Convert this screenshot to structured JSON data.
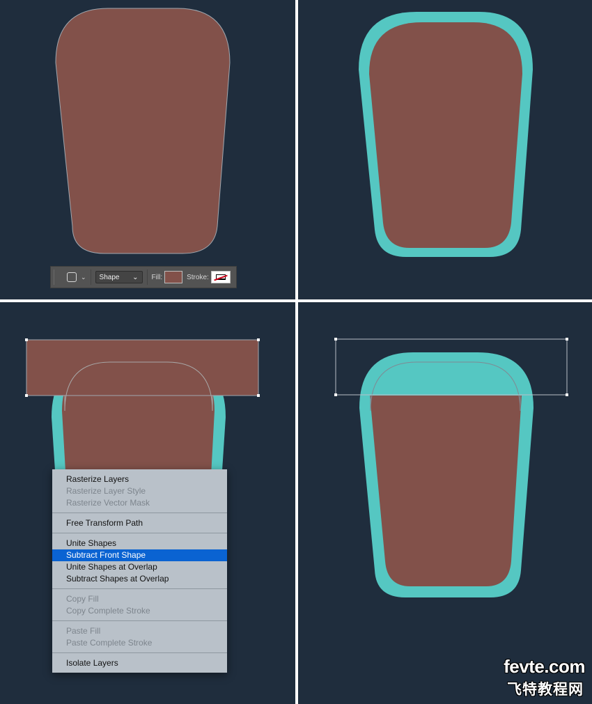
{
  "options_bar": {
    "shape_tool_icon": "rounded-rectangle-tool-icon",
    "mode_value": "Shape",
    "fill_label": "Fill:",
    "stroke_label": "Stroke:",
    "fill_color": "#82514a",
    "stroke_color": "none"
  },
  "colors": {
    "background": "#1f2d3d",
    "cup_fill": "#82514a",
    "cup_stroke": "#55c7c2",
    "menu_highlight": "#0a63d2"
  },
  "context_menu": {
    "groups": [
      [
        {
          "label": "Rasterize Layers",
          "state": "enabled"
        },
        {
          "label": "Rasterize Layer Style",
          "state": "disabled"
        },
        {
          "label": "Rasterize Vector Mask",
          "state": "disabled"
        }
      ],
      [
        {
          "label": "Free Transform Path",
          "state": "enabled"
        }
      ],
      [
        {
          "label": "Unite Shapes",
          "state": "enabled"
        },
        {
          "label": "Subtract Front Shape",
          "state": "selected"
        },
        {
          "label": "Unite Shapes at Overlap",
          "state": "enabled"
        },
        {
          "label": "Subtract Shapes at Overlap",
          "state": "enabled"
        }
      ],
      [
        {
          "label": "Copy Fill",
          "state": "disabled"
        },
        {
          "label": "Copy Complete Stroke",
          "state": "disabled"
        }
      ],
      [
        {
          "label": "Paste Fill",
          "state": "disabled"
        },
        {
          "label": "Paste Complete Stroke",
          "state": "disabled"
        }
      ],
      [
        {
          "label": "Isolate Layers",
          "state": "enabled"
        }
      ]
    ]
  },
  "watermark": {
    "line1": "fevte.com",
    "line2": "飞特教程网"
  }
}
